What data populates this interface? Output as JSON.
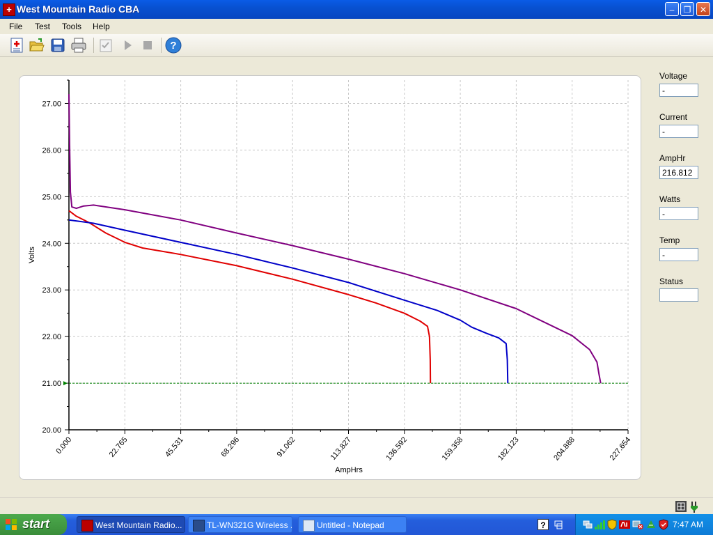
{
  "window": {
    "title": "West Mountain Radio CBA",
    "minimize": "–",
    "maximize": "❐",
    "close": "✕"
  },
  "menu": [
    "File",
    "Test",
    "Tools",
    "Help"
  ],
  "toolbar": {
    "icons": [
      "new-test-icon",
      "open-icon",
      "save-icon",
      "print-icon",
      "checklist-icon",
      "play-icon",
      "stop-icon",
      "help-icon"
    ]
  },
  "readouts": [
    {
      "label": "Voltage",
      "value": "-"
    },
    {
      "label": "Current",
      "value": "-"
    },
    {
      "label": "AmpHr",
      "value": "216.812"
    },
    {
      "label": "Watts",
      "value": "-"
    },
    {
      "label": "Temp",
      "value": "-"
    },
    {
      "label": "Status",
      "value": ""
    }
  ],
  "chart_data": {
    "type": "line",
    "xlabel": "AmpHrs",
    "ylabel": "Volts",
    "xlim": [
      0,
      227.654
    ],
    "ylim": [
      20,
      27.5
    ],
    "x_ticks": [
      "0.000",
      "22.765",
      "45.531",
      "68.296",
      "91.062",
      "113.827",
      "136.592",
      "159.358",
      "182.123",
      "204.888",
      "227.654"
    ],
    "y_ticks": [
      "20.00",
      "21.00",
      "22.00",
      "23.00",
      "24.00",
      "25.00",
      "26.00",
      "27.00"
    ],
    "grid": true,
    "cutoff_line": {
      "y": 21.0,
      "color": "#008000"
    },
    "series": [
      {
        "color": "#E00000",
        "points": [
          [
            0,
            24.7
          ],
          [
            3,
            24.58
          ],
          [
            8,
            24.45
          ],
          [
            15,
            24.22
          ],
          [
            22.8,
            24.02
          ],
          [
            30,
            23.9
          ],
          [
            45.5,
            23.76
          ],
          [
            68.3,
            23.52
          ],
          [
            91.1,
            23.23
          ],
          [
            113.8,
            22.9
          ],
          [
            125,
            22.72
          ],
          [
            136.6,
            22.5
          ],
          [
            143,
            22.33
          ],
          [
            146,
            22.22
          ],
          [
            146.8,
            22.0
          ],
          [
            147.1,
            21.5
          ],
          [
            147.2,
            21.0
          ]
        ]
      },
      {
        "color": "#0000C8",
        "points": [
          [
            0,
            24.5
          ],
          [
            10,
            24.43
          ],
          [
            22.8,
            24.28
          ],
          [
            45.5,
            24.02
          ],
          [
            68.3,
            23.76
          ],
          [
            91.1,
            23.47
          ],
          [
            113.8,
            23.16
          ],
          [
            136.6,
            22.78
          ],
          [
            150,
            22.56
          ],
          [
            159.4,
            22.35
          ],
          [
            164,
            22.2
          ],
          [
            170,
            22.07
          ],
          [
            175,
            21.97
          ],
          [
            178,
            21.85
          ],
          [
            178.5,
            21.5
          ],
          [
            178.7,
            21.0
          ]
        ]
      },
      {
        "color": "#800080",
        "points": [
          [
            0,
            27.2
          ],
          [
            0.3,
            26.0
          ],
          [
            0.6,
            25.1
          ],
          [
            1.2,
            24.78
          ],
          [
            3,
            24.75
          ],
          [
            6,
            24.8
          ],
          [
            10,
            24.82
          ],
          [
            22.8,
            24.72
          ],
          [
            45.5,
            24.5
          ],
          [
            68.3,
            24.22
          ],
          [
            91.1,
            23.95
          ],
          [
            113.8,
            23.66
          ],
          [
            136.6,
            23.35
          ],
          [
            159.4,
            23.0
          ],
          [
            182.1,
            22.6
          ],
          [
            204.9,
            22.02
          ],
          [
            212,
            21.72
          ],
          [
            215,
            21.45
          ],
          [
            215.8,
            21.2
          ],
          [
            216.5,
            21.0
          ]
        ]
      }
    ]
  },
  "taskbar": {
    "start": "start",
    "tasks": [
      {
        "label": "West Mountain Radio...",
        "active": true
      },
      {
        "label": "TL-WN321G Wireless ...",
        "active": false
      },
      {
        "label": "Untitled - Notepad",
        "active": false
      }
    ],
    "clock": "7:47 AM"
  }
}
